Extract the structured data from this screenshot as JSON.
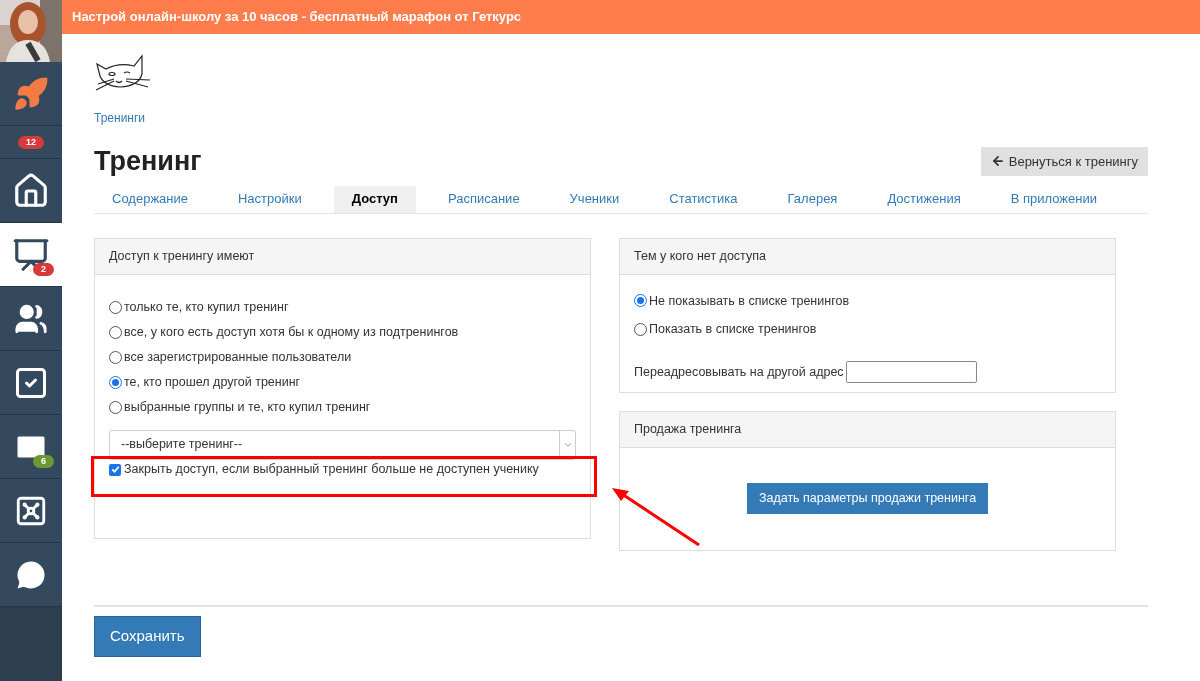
{
  "banner": {
    "text": "Настрой онлайн-школу за 10 часов - бесплатный марафон от Геткурс"
  },
  "sidebar": {
    "items": [
      {
        "kind": "rocket",
        "selected": false
      },
      {
        "kind": "counter",
        "selected": false,
        "badge": "12",
        "color": "#d63a3a"
      },
      {
        "kind": "home",
        "selected": false
      },
      {
        "kind": "chart",
        "selected": true,
        "badge": "2",
        "color": "#d63a3a"
      },
      {
        "kind": "users",
        "selected": false
      },
      {
        "kind": "tasks",
        "selected": false
      },
      {
        "kind": "mail",
        "selected": false,
        "badge": "6",
        "color": "#6a9a34"
      },
      {
        "kind": "safe",
        "selected": false
      },
      {
        "kind": "chat",
        "selected": false
      }
    ]
  },
  "breadcrumb": "Тренинги",
  "title": "Тренинг",
  "back_button": "Вернуться к тренингу",
  "tabs": [
    {
      "label": "Содержание",
      "selected": false
    },
    {
      "label": "Настройки",
      "selected": false
    },
    {
      "label": "Доступ",
      "selected": true
    },
    {
      "label": "Расписание",
      "selected": false
    },
    {
      "label": "Ученики",
      "selected": false
    },
    {
      "label": "Статистика",
      "selected": false
    },
    {
      "label": "Галерея",
      "selected": false
    },
    {
      "label": "Достижения",
      "selected": false
    },
    {
      "label": "В приложении",
      "selected": false
    }
  ],
  "access_panel": {
    "title": "Доступ к тренингу имеют",
    "options": [
      {
        "label": "только те, кто купил тренинг",
        "selected": false
      },
      {
        "label": "все, у кого есть доступ хотя бы к одному из подтренингов",
        "selected": false
      },
      {
        "label": "все зарегистрированные пользователи",
        "selected": false
      },
      {
        "label": "те, кто прошел другой тренинг",
        "selected": true
      },
      {
        "label": "выбранные группы и те, кто купил тренинг",
        "selected": false
      }
    ],
    "select": {
      "value": "--выберите тренинг--"
    },
    "checkbox": {
      "label": "Закрыть доступ, если выбранный тренинг больше не доступен ученику",
      "checked": true
    }
  },
  "no_access_panel": {
    "title": "Тем у кого нет доступа",
    "options": [
      {
        "label": "Не показывать в списке тренингов",
        "selected": true
      },
      {
        "label": "Показать в списке тренингов",
        "selected": false
      }
    ],
    "redirect_label": "Переадресовывать на другой адрес"
  },
  "sale_panel": {
    "title": "Продажа тренинга",
    "button": "Задать параметры продажи тренинга"
  },
  "save_button": "Сохранить"
}
